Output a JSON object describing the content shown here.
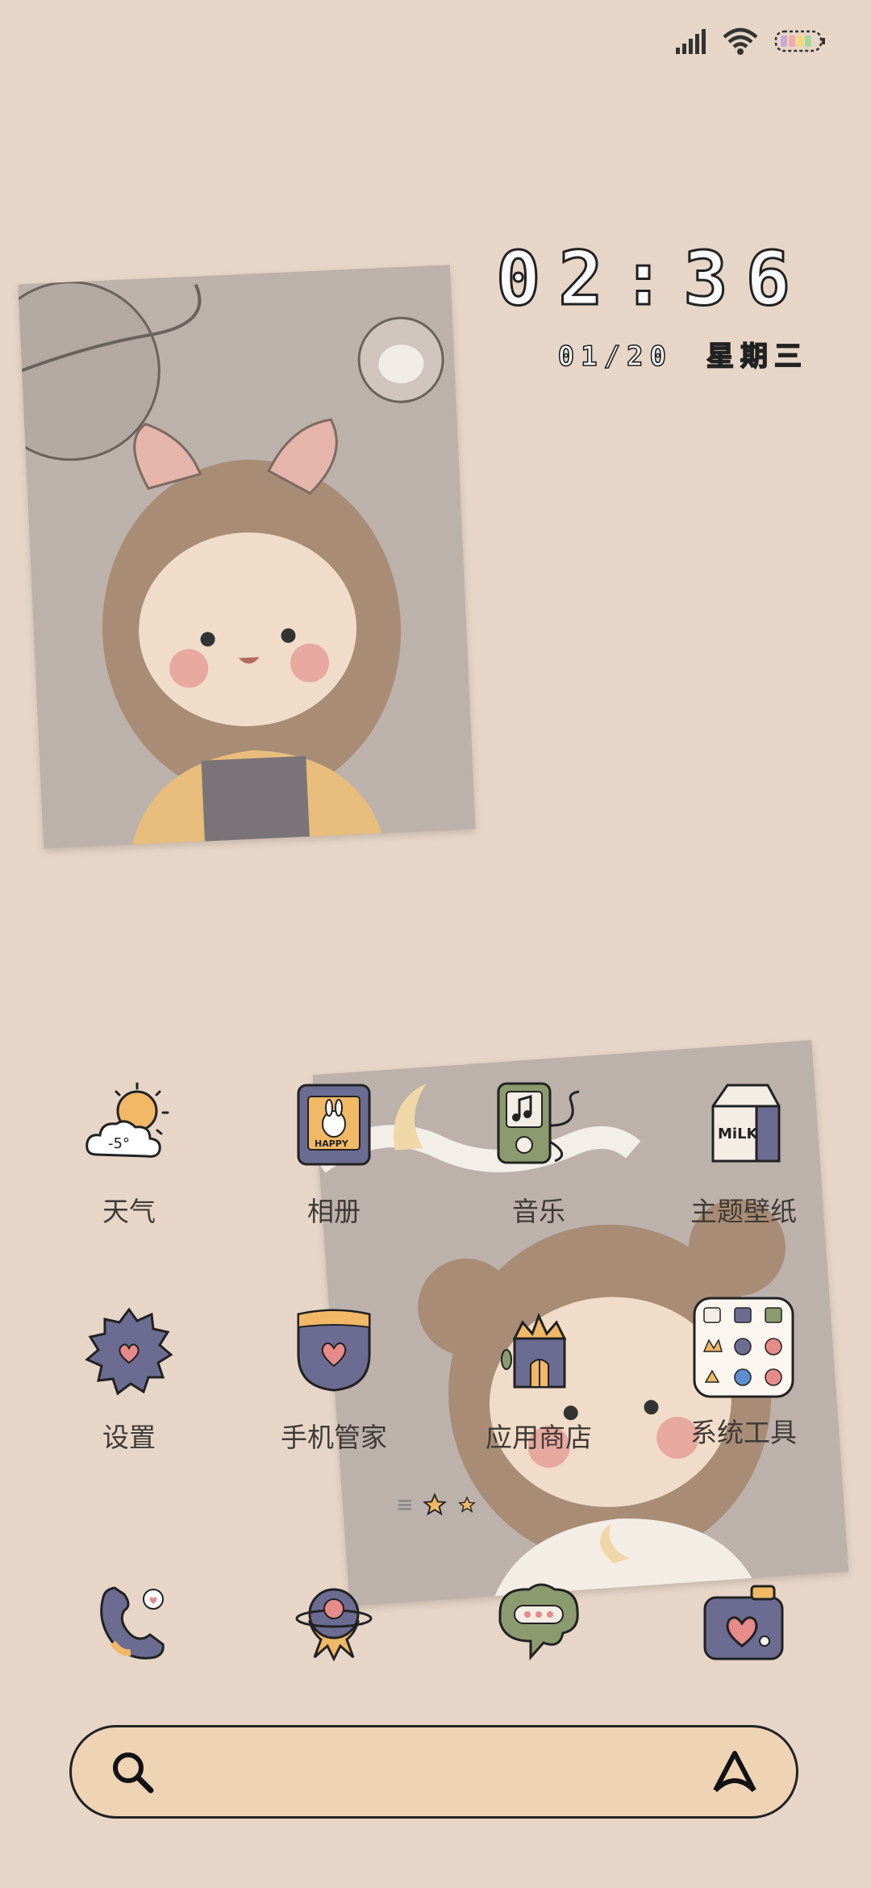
{
  "status_bar": {
    "signal_icon": "signal-bars-icon",
    "wifi_icon": "wifi-icon",
    "battery_icon": "battery-icon"
  },
  "clock": {
    "time": "02:36",
    "date": "01/20",
    "weekday": "星期三"
  },
  "weather": {
    "temperature": "-5°"
  },
  "apps_row1": [
    {
      "label": "天气",
      "icon": "weather-icon"
    },
    {
      "label": "相册",
      "icon": "gallery-icon"
    },
    {
      "label": "音乐",
      "icon": "music-icon"
    },
    {
      "label": "主题壁纸",
      "icon": "milk-carton-icon"
    }
  ],
  "apps_row2": [
    {
      "label": "设置",
      "icon": "gear-icon"
    },
    {
      "label": "手机管家",
      "icon": "shield-icon"
    },
    {
      "label": "应用商店",
      "icon": "store-house-icon"
    },
    {
      "label": "系统工具",
      "icon": "folder-icon"
    }
  ],
  "gallery_label": "HAPPY",
  "milk_label": "MiLK",
  "dock": [
    {
      "icon": "phone-icon"
    },
    {
      "icon": "browser-icon"
    },
    {
      "icon": "message-icon"
    },
    {
      "icon": "camera-icon"
    }
  ],
  "search_bar": {
    "search_icon": "search-icon",
    "assistant_icon": "assistant-icon"
  },
  "colors": {
    "background": "#e7d6c8",
    "search_fill": "#efd3b5",
    "icon_purple": "#6c6c93",
    "photo_fill": "#bcb1ab"
  }
}
